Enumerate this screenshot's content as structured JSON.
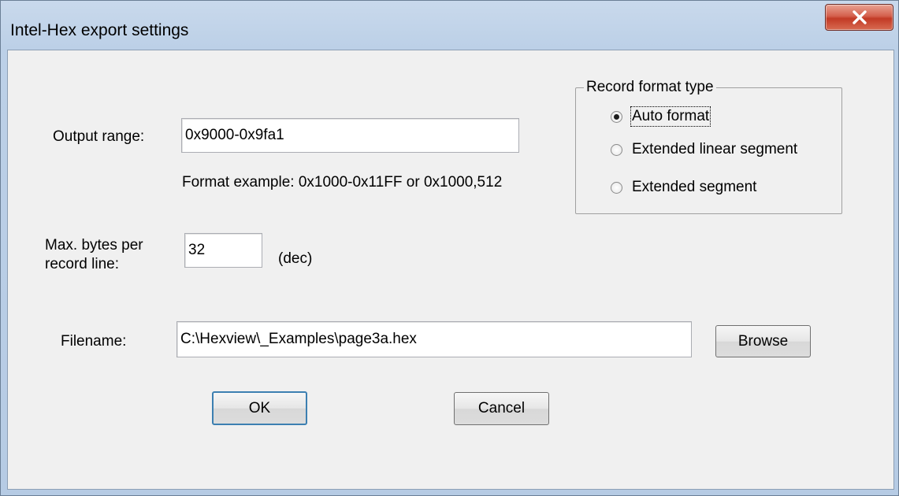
{
  "window": {
    "title": "Intel-Hex export settings"
  },
  "output_range": {
    "label": "Output range:",
    "value": "0x9000-0x9fa1",
    "format_example": "Format example: 0x1000-0x11FF or 0x1000,512"
  },
  "max_bytes": {
    "label_line1": "Max. bytes per",
    "label_line2": "record line:",
    "value": "32",
    "unit": "(dec)"
  },
  "record_format": {
    "title": "Record format type",
    "options": [
      {
        "label": "Auto format",
        "checked": true
      },
      {
        "label": "Extended linear segment",
        "checked": false
      },
      {
        "label": "Extended segment",
        "checked": false
      }
    ]
  },
  "filename": {
    "label": "Filename:",
    "value": "C:\\Hexview\\_Examples\\page3a.hex",
    "browse_label": "Browse"
  },
  "buttons": {
    "ok_label": "OK",
    "cancel_label": "Cancel"
  }
}
